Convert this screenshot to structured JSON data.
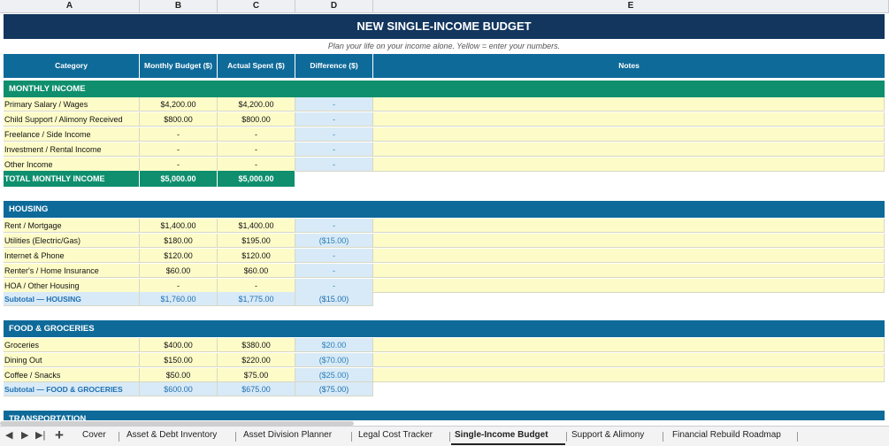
{
  "columns": [
    "A",
    "B",
    "C",
    "D",
    "E"
  ],
  "title": "NEW SINGLE-INCOME BUDGET",
  "subtitle": "Plan your life on your income alone. Yellow = enter your numbers.",
  "headers": {
    "category": "Category",
    "budget": "Monthly Budget ($)",
    "actual": "Actual Spent ($)",
    "diff": "Difference ($)",
    "notes": "Notes"
  },
  "colors": {
    "title_bg": "#12365e",
    "header_bg": "#0e6a99",
    "income_section": "#0f8f6e",
    "section_bg": "#0e6a99",
    "input_yellow": "#fdfcc8",
    "calc_blue": "#d8eaf7"
  },
  "income": {
    "section": "MONTHLY INCOME",
    "rows": [
      {
        "cat": "Primary Salary / Wages",
        "budget": "$4,200.00",
        "actual": "$4,200.00",
        "diff": "-"
      },
      {
        "cat": "Child Support / Alimony Received",
        "budget": "$800.00",
        "actual": "$800.00",
        "diff": "-"
      },
      {
        "cat": "Freelance / Side Income",
        "budget": "-",
        "actual": "-",
        "diff": "-"
      },
      {
        "cat": "Investment / Rental Income",
        "budget": "-",
        "actual": "-",
        "diff": "-"
      },
      {
        "cat": "Other Income",
        "budget": "-",
        "actual": "-",
        "diff": "-"
      }
    ],
    "total": {
      "label": "TOTAL MONTHLY INCOME",
      "budget": "$5,000.00",
      "actual": "$5,000.00"
    }
  },
  "housing": {
    "section": "HOUSING",
    "rows": [
      {
        "cat": "Rent / Mortgage",
        "budget": "$1,400.00",
        "actual": "$1,400.00",
        "diff": "-"
      },
      {
        "cat": "Utilities (Electric/Gas)",
        "budget": "$180.00",
        "actual": "$195.00",
        "diff": "($15.00)"
      },
      {
        "cat": "Internet & Phone",
        "budget": "$120.00",
        "actual": "$120.00",
        "diff": "-"
      },
      {
        "cat": "Renter's / Home Insurance",
        "budget": "$60.00",
        "actual": "$60.00",
        "diff": "-"
      },
      {
        "cat": "HOA / Other Housing",
        "budget": "-",
        "actual": "-",
        "diff": "-"
      }
    ],
    "subtotal": {
      "label": "Subtotal — HOUSING",
      "budget": "$1,760.00",
      "actual": "$1,775.00",
      "diff": "($15.00)"
    }
  },
  "food": {
    "section": "FOOD & GROCERIES",
    "rows": [
      {
        "cat": "Groceries",
        "budget": "$400.00",
        "actual": "$380.00",
        "diff": "$20.00"
      },
      {
        "cat": "Dining Out",
        "budget": "$150.00",
        "actual": "$220.00",
        "diff": "($70.00)"
      },
      {
        "cat": "Coffee / Snacks",
        "budget": "$50.00",
        "actual": "$75.00",
        "diff": "($25.00)"
      }
    ],
    "subtotal": {
      "label": "Subtotal — FOOD & GROCERIES",
      "budget": "$600.00",
      "actual": "$675.00",
      "diff": "($75.00)"
    }
  },
  "next_section": "TRANSPORTATION",
  "tabs": [
    "Cover",
    "Asset & Debt Inventory",
    "Asset Division Planner",
    "Legal Cost Tracker",
    "Single-Income Budget",
    "Support & Alimony",
    "Financial Rebuild Roadmap"
  ],
  "active_tab": "Single-Income Budget",
  "tab_add_label": "+",
  "tab_nav": [
    "◀",
    "▶",
    "▶|"
  ]
}
